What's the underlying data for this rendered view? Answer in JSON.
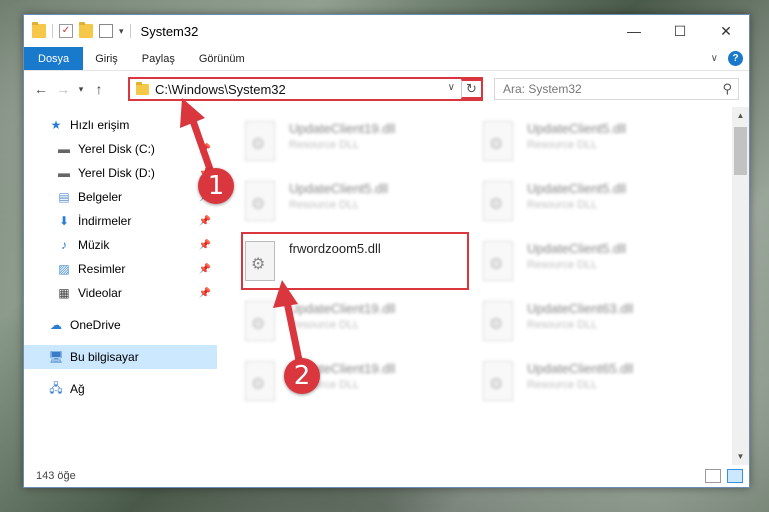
{
  "window": {
    "title": "System32",
    "controls": {
      "minimize": "—",
      "maximize": "☐",
      "close": "✕"
    }
  },
  "quick_access_toolbar": {
    "dropdown": "▾"
  },
  "ribbon": {
    "tabs": [
      "Dosya",
      "Giriş",
      "Paylaş",
      "Görünüm"
    ],
    "help": "?"
  },
  "nav": {
    "back": "←",
    "forward": "→",
    "recent": "▾",
    "up": "↑",
    "address": "C:\\Windows\\System32",
    "address_dropdown": "∨",
    "refresh": "↻",
    "search_placeholder": "Ara: System32"
  },
  "sidebar": {
    "items": [
      {
        "label": "Hızlı erişim",
        "icon": "star-icon"
      },
      {
        "label": "Yerel Disk (C:)",
        "icon": "drive-icon",
        "pinned": true
      },
      {
        "label": "Yerel Disk (D:)",
        "icon": "drive-icon",
        "pinned": true
      },
      {
        "label": "Belgeler",
        "icon": "documents-icon",
        "pinned": true
      },
      {
        "label": "İndirmeler",
        "icon": "download-icon",
        "pinned": true
      },
      {
        "label": "Müzik",
        "icon": "music-icon",
        "pinned": true
      },
      {
        "label": "Resimler",
        "icon": "pictures-icon",
        "pinned": true
      },
      {
        "label": "Videolar",
        "icon": "videos-icon",
        "pinned": true
      },
      {
        "label": "OneDrive",
        "icon": "cloud-icon"
      },
      {
        "label": "Bu bilgisayar",
        "icon": "computer-icon",
        "selected": true
      },
      {
        "label": "Ağ",
        "icon": "network-icon"
      }
    ]
  },
  "files": [
    {
      "name": "UpdateClient19.dll",
      "type": "Resource DLL"
    },
    {
      "name": "UpdateClient5.dll",
      "type": "Resource DLL"
    },
    {
      "name": "UpdateClient5.dll",
      "type": "Resource DLL"
    },
    {
      "name": "UpdateClient5.dll",
      "type": "Resource DLL"
    },
    {
      "name": "frwordzoom5.dll",
      "type": "",
      "highlighted": true
    },
    {
      "name": "UpdateClient5.dll",
      "type": "Resource DLL"
    },
    {
      "name": "UpdateClient19.dll",
      "type": "Resource DLL"
    },
    {
      "name": "UpdateClient63.dll",
      "type": "Resource DLL"
    },
    {
      "name": "UpdateClient19.dll",
      "type": "Resource DLL"
    },
    {
      "name": "UpdateClient65.dll",
      "type": "Resource DLL"
    }
  ],
  "status": {
    "item_count": "143 öğe"
  },
  "callouts": {
    "one": "1",
    "two": "2"
  },
  "colors": {
    "accent": "#1979ca",
    "highlight_red": "#d9363e",
    "selection": "#cce8ff"
  }
}
